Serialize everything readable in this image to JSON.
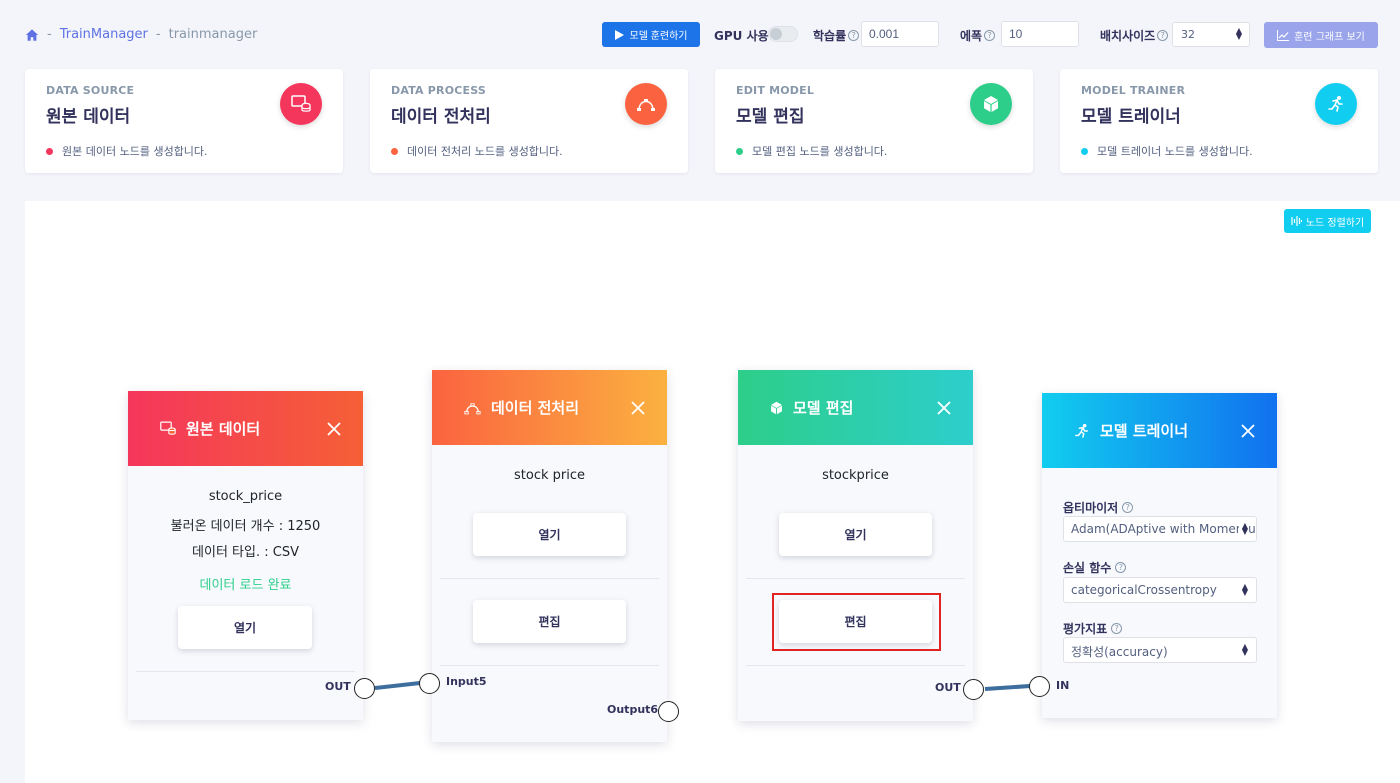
{
  "breadcrumb": {
    "app": "TrainManager",
    "project": "trainmanager",
    "separator": "-"
  },
  "toolbar": {
    "train_label": "모델 훈련하기",
    "gpu_label": "GPU 사용",
    "gpu_enabled": false,
    "lr_label": "학습률",
    "lr_value": "0.001",
    "epoch_label": "에폭",
    "epoch_value": "10",
    "batch_label": "배치사이즈",
    "batch_value": "32",
    "graph_label": "훈련 그래프 보기"
  },
  "categories": [
    {
      "en": "DATA SOURCE",
      "ko": "원본 데이터",
      "desc": "원본 데이터 노드를 생성합니다.",
      "color": "#f5365c",
      "icon": "database-monitor-icon"
    },
    {
      "en": "DATA PROCESS",
      "ko": "데이터 전처리",
      "desc": "데이터 전처리 노드를 생성합니다.",
      "color": "#fb6340",
      "icon": "bezier-curve-icon"
    },
    {
      "en": "EDIT MODEL",
      "ko": "모델 편집",
      "desc": "모델 편집 노드를 생성합니다.",
      "color": "#2dce89",
      "icon": "cube-icon"
    },
    {
      "en": "MODEL TRAINER",
      "ko": "모델 트레이너",
      "desc": "모델 트레이너 노드를 생성합니다.",
      "color": "#11cdef",
      "icon": "running-person-icon"
    }
  ],
  "canvas": {
    "align_label": "노드 정렬하기"
  },
  "nodes": {
    "source": {
      "title": "원본 데이터",
      "name": "stock_price",
      "count_text": "불러온 데이터 개수 : 1250",
      "type_text": "데이터 타입. : CSV",
      "status_text": "데이터 로드 완료",
      "open_label": "열기",
      "out_label": "OUT"
    },
    "process": {
      "title": "데이터 전처리",
      "name": "stock price",
      "open_label": "열기",
      "edit_label": "편집",
      "input_label": "Input5",
      "output_label": "Output6"
    },
    "model": {
      "title": "모델 편집",
      "name": "stockprice",
      "open_label": "열기",
      "edit_label": "편집",
      "out_label": "OUT"
    },
    "trainer": {
      "title": "모델 트레이너",
      "optimizer_label": "옵티마이저",
      "optimizer_value": "Adam(ADAptive with Momentum)",
      "loss_label": "손실 함수",
      "loss_value": "categoricalCrossentropy",
      "metric_label": "평가지표",
      "metric_value": "정확성(accuracy)",
      "in_label": "IN"
    }
  },
  "colors": {
    "primary": "#1d73e8",
    "status_success": "#2dce89",
    "highlight": "#e02424",
    "edge": "#3d6e9e"
  }
}
